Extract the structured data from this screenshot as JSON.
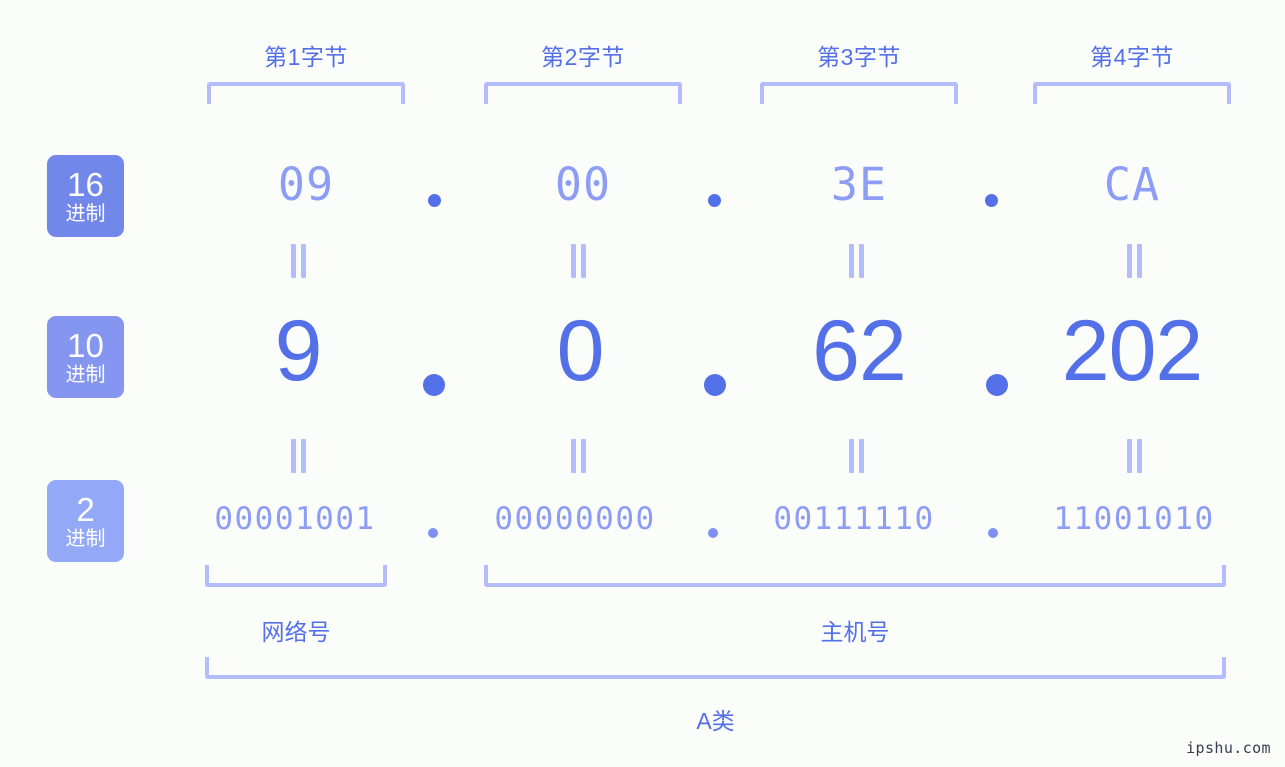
{
  "meta": {
    "watermark": "ipshu.com",
    "background_color": "#fbfdfa",
    "accent_color": "#5470e8",
    "accent_light_color": "#8d9cf5",
    "bracket_color": "#b3bdfb"
  },
  "byte_headers": [
    {
      "label": "第1字节"
    },
    {
      "label": "第2字节"
    },
    {
      "label": "第3字节"
    },
    {
      "label": "第4字节"
    }
  ],
  "rows": [
    {
      "badge": {
        "num": "16",
        "unit": "进制",
        "color": "#7287ea"
      },
      "values": [
        "09",
        "00",
        "3E",
        "CA"
      ],
      "separator": "."
    },
    {
      "badge": {
        "num": "10",
        "unit": "进制",
        "color": "#8596f1"
      },
      "values": [
        "9",
        "0",
        "62",
        "202"
      ],
      "separator": "."
    },
    {
      "badge": {
        "num": "2",
        "unit": "进制",
        "color": "#93a8f6"
      },
      "values": [
        "00001001",
        "00000000",
        "00111110",
        "11001010"
      ],
      "separator": "."
    }
  ],
  "equals_symbol": "=",
  "segments": [
    {
      "label": "网络号"
    },
    {
      "label": "主机号"
    }
  ],
  "address_class": {
    "label": "A类"
  }
}
